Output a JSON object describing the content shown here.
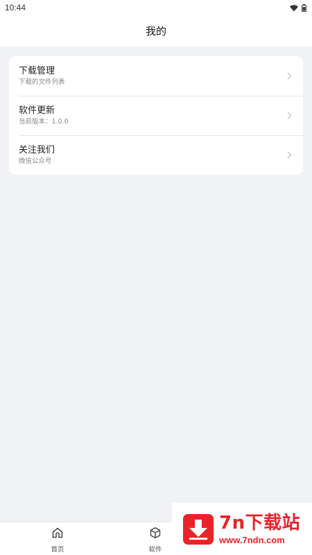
{
  "status_bar": {
    "time": "10:44"
  },
  "header": {
    "title": "我的"
  },
  "menu": [
    {
      "title": "下载管理",
      "subtitle": "下载的文件列表"
    },
    {
      "title": "软件更新",
      "subtitle": "当前版本：1.0.0"
    },
    {
      "title": "关注我们",
      "subtitle": "微信公众号"
    }
  ],
  "bottom_nav": [
    {
      "label": "首页",
      "icon": "home-icon"
    },
    {
      "label": "软件",
      "icon": "package-icon"
    }
  ],
  "watermark": {
    "name": "7n下载站",
    "url": "www.7ndn.com"
  },
  "colors": {
    "accent": "#e8242a",
    "background": "#f0f2f5"
  }
}
